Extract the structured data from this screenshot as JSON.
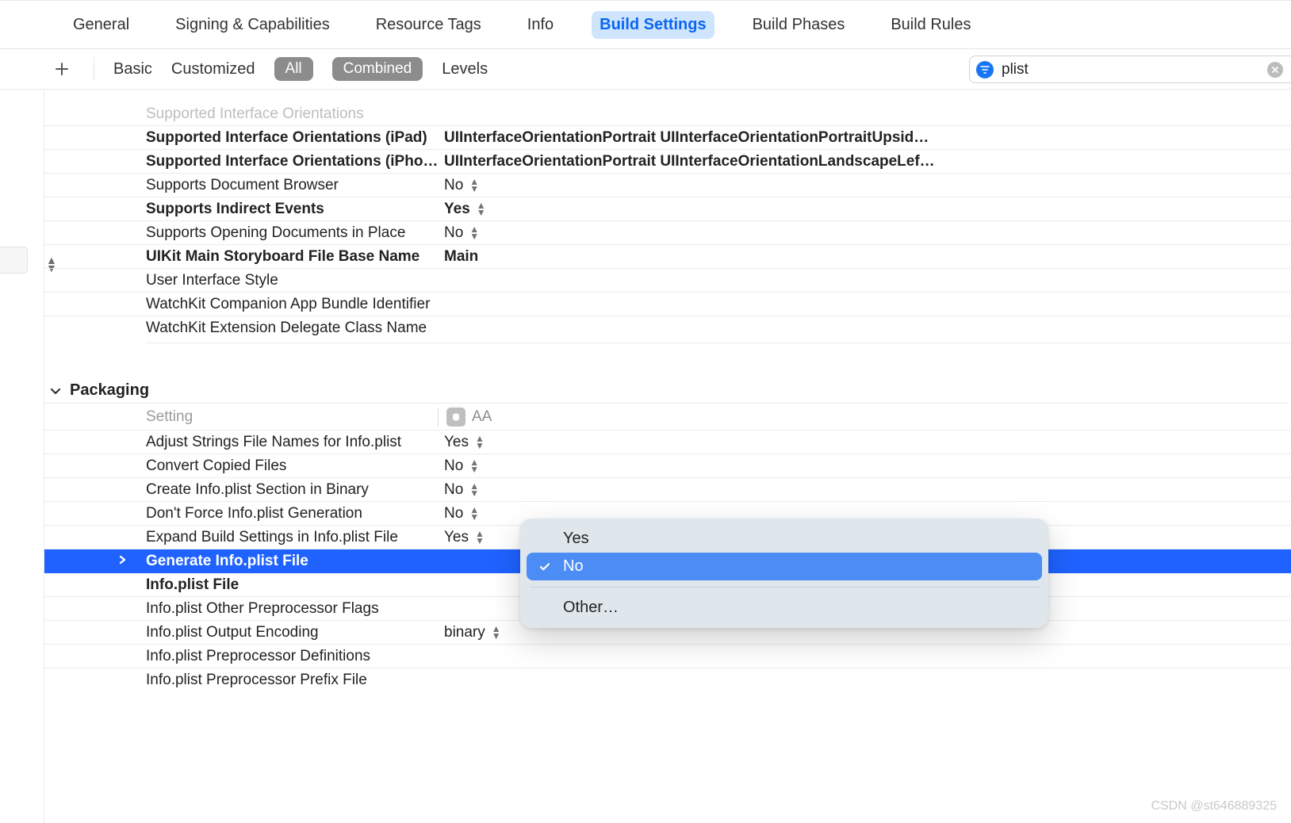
{
  "tabs": {
    "items": [
      {
        "label": "General"
      },
      {
        "label": "Signing & Capabilities"
      },
      {
        "label": "Resource Tags"
      },
      {
        "label": "Info"
      },
      {
        "label": "Build Settings",
        "active": true
      },
      {
        "label": "Build Phases"
      },
      {
        "label": "Build Rules"
      }
    ]
  },
  "filters": {
    "basic": "Basic",
    "customized": "Customized",
    "all": "All",
    "combined": "Combined",
    "levels": "Levels",
    "search_value": "plist"
  },
  "top_section": {
    "truncated_row": "Supported Interface Orientations",
    "rows": [
      {
        "key": "Supported Interface Orientations (iPad)",
        "value": "UIInterfaceOrientationPortrait UIInterfaceOrientationPortraitUpsid…",
        "bold": true
      },
      {
        "key": "Supported Interface Orientations (iPhone)",
        "value": "UIInterfaceOrientationPortrait UIInterfaceOrientationLandscapeLef…",
        "bold": true
      },
      {
        "key": "Supports Document Browser",
        "value": "No",
        "stepper": true
      },
      {
        "key": "Supports Indirect Events",
        "value": "Yes",
        "bold": true,
        "stepper": true
      },
      {
        "key": "Supports Opening Documents in Place",
        "value": "No",
        "stepper": true
      },
      {
        "key": "UIKit Main Storyboard File Base Name",
        "value": "Main",
        "bold": true
      },
      {
        "key": "User Interface Style",
        "value": ""
      },
      {
        "key": "WatchKit Companion App Bundle Identifier",
        "value": ""
      },
      {
        "key": "WatchKit Extension Delegate Class Name",
        "value": ""
      }
    ]
  },
  "packaging": {
    "title": "Packaging",
    "header": {
      "setting": "Setting",
      "target_letters": "AA"
    },
    "rows": [
      {
        "key": "Adjust Strings File Names for Info.plist",
        "value": "Yes",
        "stepper": true
      },
      {
        "key": "Convert Copied Files",
        "value": "No",
        "stepper": true
      },
      {
        "key": "Create Info.plist Section in Binary",
        "value": "No",
        "stepper": true
      },
      {
        "key": "Don't Force Info.plist Generation",
        "value": "No",
        "stepper": true
      },
      {
        "key": "Expand Build Settings in Info.plist File",
        "value": "Yes",
        "stepper": true
      },
      {
        "key": "Generate Info.plist File",
        "value": "",
        "bold": true,
        "selected": true,
        "disclosure": true
      },
      {
        "key": "Info.plist File",
        "value": "",
        "bold": true
      },
      {
        "key": "Info.plist Other Preprocessor Flags",
        "value": ""
      },
      {
        "key": "Info.plist Output Encoding",
        "value": "binary",
        "stepper": true
      },
      {
        "key": "Info.plist Preprocessor Definitions",
        "value": ""
      },
      {
        "key": "Info.plist Preprocessor Prefix File",
        "value": ""
      }
    ]
  },
  "popover": {
    "options": [
      {
        "label": "Yes",
        "checked": false
      },
      {
        "label": "No",
        "checked": true,
        "highlight": true
      }
    ],
    "other": "Other…"
  },
  "watermark": "CSDN @st646889325"
}
